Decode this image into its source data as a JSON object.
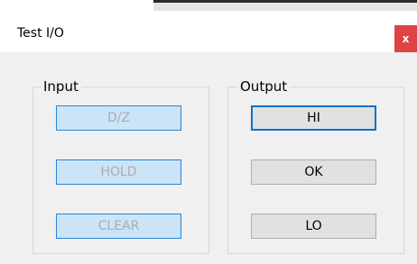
{
  "window": {
    "title": "Test I/O",
    "close_glyph": "x"
  },
  "input_group": {
    "label": "Input",
    "buttons": [
      "D/Z",
      "HOLD",
      "CLEAR"
    ]
  },
  "output_group": {
    "label": "Output",
    "buttons": [
      "HI",
      "OK",
      "LO"
    ]
  },
  "colors": {
    "close_button": "#e04343",
    "disabled_button_fill": "#cce4f7",
    "disabled_button_border": "#2b84d4",
    "focus_border": "#0f6fc6",
    "dialog_background": "#f0f0f0"
  },
  "icons": {
    "close": "close-icon"
  }
}
